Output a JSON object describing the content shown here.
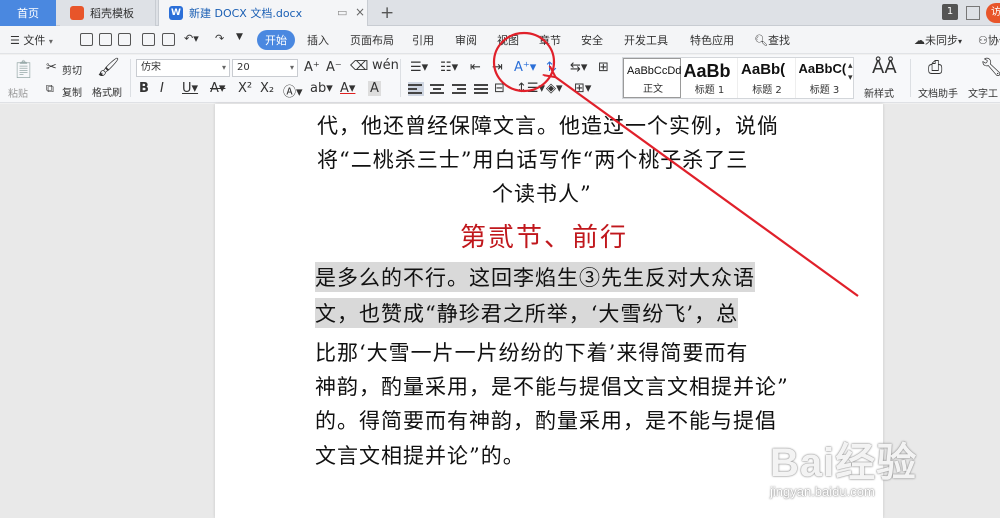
{
  "tabs": {
    "home": "首页",
    "templates": "稻壳模板",
    "document": "新建 DOCX 文档.docx",
    "counter": "1",
    "visitor": "访客"
  },
  "menu": {
    "file": "文件",
    "items": [
      "开始",
      "插入",
      "页面布局",
      "引用",
      "审阅",
      "视图",
      "章节",
      "安全",
      "开发工具",
      "特色应用"
    ],
    "search": "查找",
    "sync": "未同步",
    "share": "协作"
  },
  "ribbon": {
    "cut": "剪切",
    "copy": "复制",
    "format_painter": "格式刷",
    "paste": "粘贴",
    "font_name": "仿宋",
    "font_size": "20",
    "styles": [
      {
        "sample": "AaBbCcDd",
        "name": "正文"
      },
      {
        "sample": "AaBb",
        "name": "标题 1"
      },
      {
        "sample": "AaBb(",
        "name": "标题 2"
      },
      {
        "sample": "AaBbC(",
        "name": "标题 3"
      }
    ],
    "new_style": "新样式",
    "doc_assistant": "文档助手",
    "text_tools": "文字工"
  },
  "document": {
    "lines_top": [
      "代，他还曾经保障文言。他造过一个实例，说倘",
      "将“二桃杀三士”用白话写作“两个桃子杀了三",
      "个读书人”"
    ],
    "heading": "第贰节、前行",
    "lines_body": [
      "是多么的不行。这回李焰生③先生反对大众语",
      "文，也赞成“静珍君之所举，‘大雪纷飞’，总",
      "比那‘大雪一片一片纷纷的下着’来得简要而有",
      "神韵，酌量采用，是不能与提倡文言文相提并论”",
      "的。得简要而有神韵，酌量采用，是不能与提倡",
      "文言文相提并论”的。"
    ]
  },
  "watermark": {
    "main": "Bai经验",
    "sub": "jingyan.baidu.com"
  },
  "colors": {
    "accent": "#4a88e0",
    "heading_red": "#c0171c",
    "annotation_red": "#e0202a",
    "selection_gray": "#d9d9d9"
  }
}
